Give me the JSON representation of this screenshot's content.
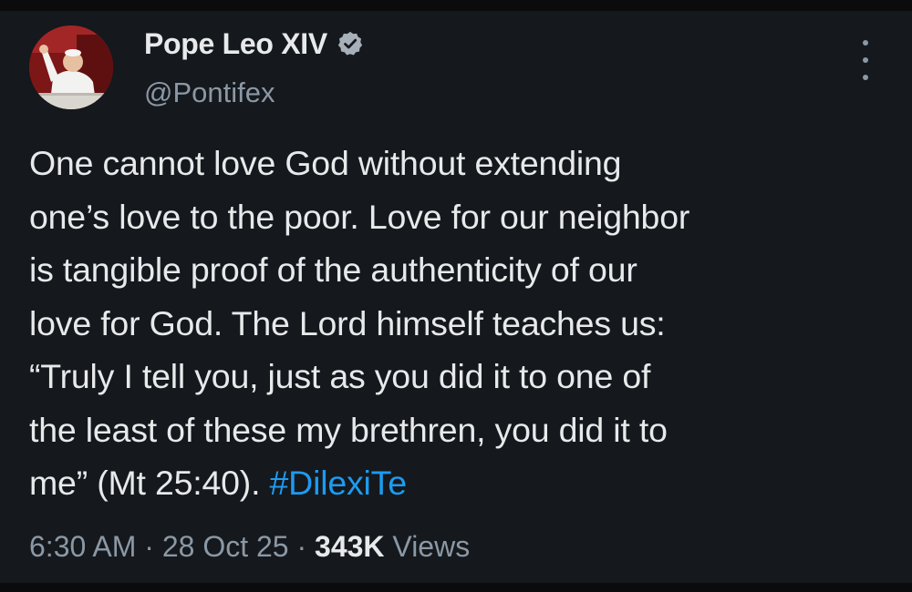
{
  "author": {
    "display_name": "Pope Leo XIV",
    "handle": "@Pontifex",
    "verified": true
  },
  "tweet": {
    "lines": [
      "One cannot love God without extending",
      "one’s love to the poor. Love for our neighbor",
      "is tangible proof of the authenticity of our",
      "love for God. The Lord himself teaches us:",
      "“Truly I tell you, just as you did it to one of",
      "the least of these my brethren, you did it to"
    ],
    "last_line_text": "me” (Mt 25:40). ",
    "hashtag": "#DilexiTe"
  },
  "meta": {
    "time": "6:30 AM",
    "separator": " · ",
    "date": "28 Oct 25",
    "views_count": "343K",
    "views_label": " Views"
  },
  "icons": {
    "verified": "verified-badge-icon",
    "more": "more-vertical-icon"
  },
  "colors": {
    "background": "#15181c",
    "text": "#e7e9ea",
    "secondary": "#8b98a5",
    "link": "#1d9bf0"
  }
}
